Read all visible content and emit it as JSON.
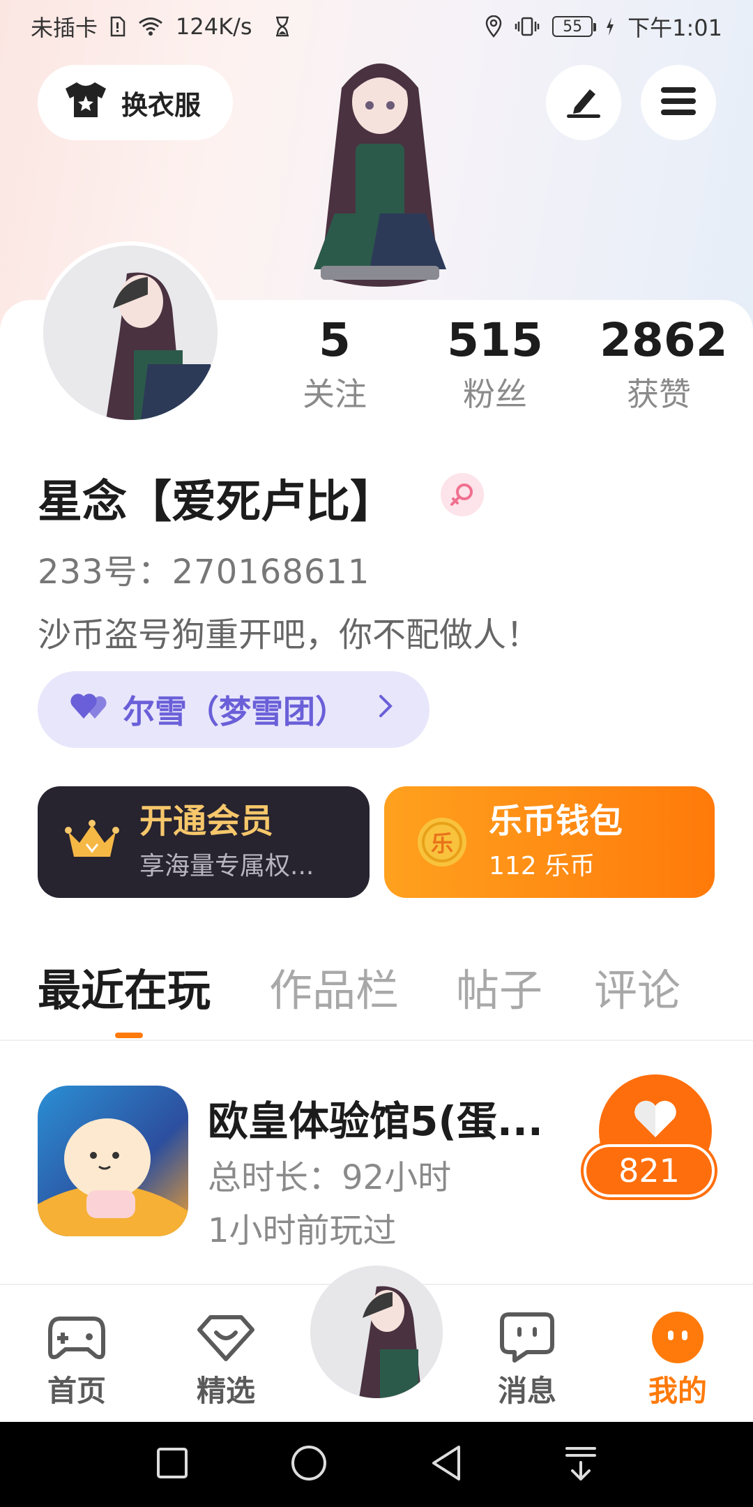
{
  "status_bar": {
    "carrier": "未插卡",
    "speed": "124K/s",
    "battery": "55",
    "time": "下午1:01"
  },
  "header": {
    "outfit_label": "换衣服",
    "outfit_icon": "shirt-icon",
    "edit_icon": "pen-icon",
    "menu_icon": "menu-icon"
  },
  "profile": {
    "stats": [
      {
        "value": "5",
        "label": "关注"
      },
      {
        "value": "515",
        "label": "粉丝"
      },
      {
        "value": "2862",
        "label": "获赞"
      }
    ],
    "username": "星念【爱死卢比】",
    "gender_icon": "female-icon",
    "uid": "233号：270168611",
    "bio": "沙币盗号狗重开吧，你不配做人！",
    "fanclub": "尔雪（梦雪团）"
  },
  "cards": {
    "vip_title": "开通会员",
    "vip_sub": "享海量专属权...",
    "wallet_title": "乐币钱包",
    "wallet_sub": "112 乐币",
    "wallet_coin_char": "乐"
  },
  "tabs": [
    "最近在玩",
    "作品栏",
    "帖子",
    "评论"
  ],
  "game": {
    "title": "欧皇体验馆5(蛋...",
    "duration": "总时长：92小时",
    "last_played": "1小时前玩过",
    "likes": "821"
  },
  "bottom_nav": [
    {
      "label": "首页",
      "icon": "gamepad-icon"
    },
    {
      "label": "精选",
      "icon": "heart-gem-icon"
    },
    {
      "label": "消息",
      "icon": "chat-icon"
    },
    {
      "label": "我的",
      "icon": "smile-icon"
    }
  ],
  "colors": {
    "accent": "#ff7a0a",
    "vip_bg": "#27232f",
    "vip_text": "#f6c76b",
    "fanclub_bg": "#e8e6fb",
    "fanclub_text": "#6a5fd8"
  }
}
